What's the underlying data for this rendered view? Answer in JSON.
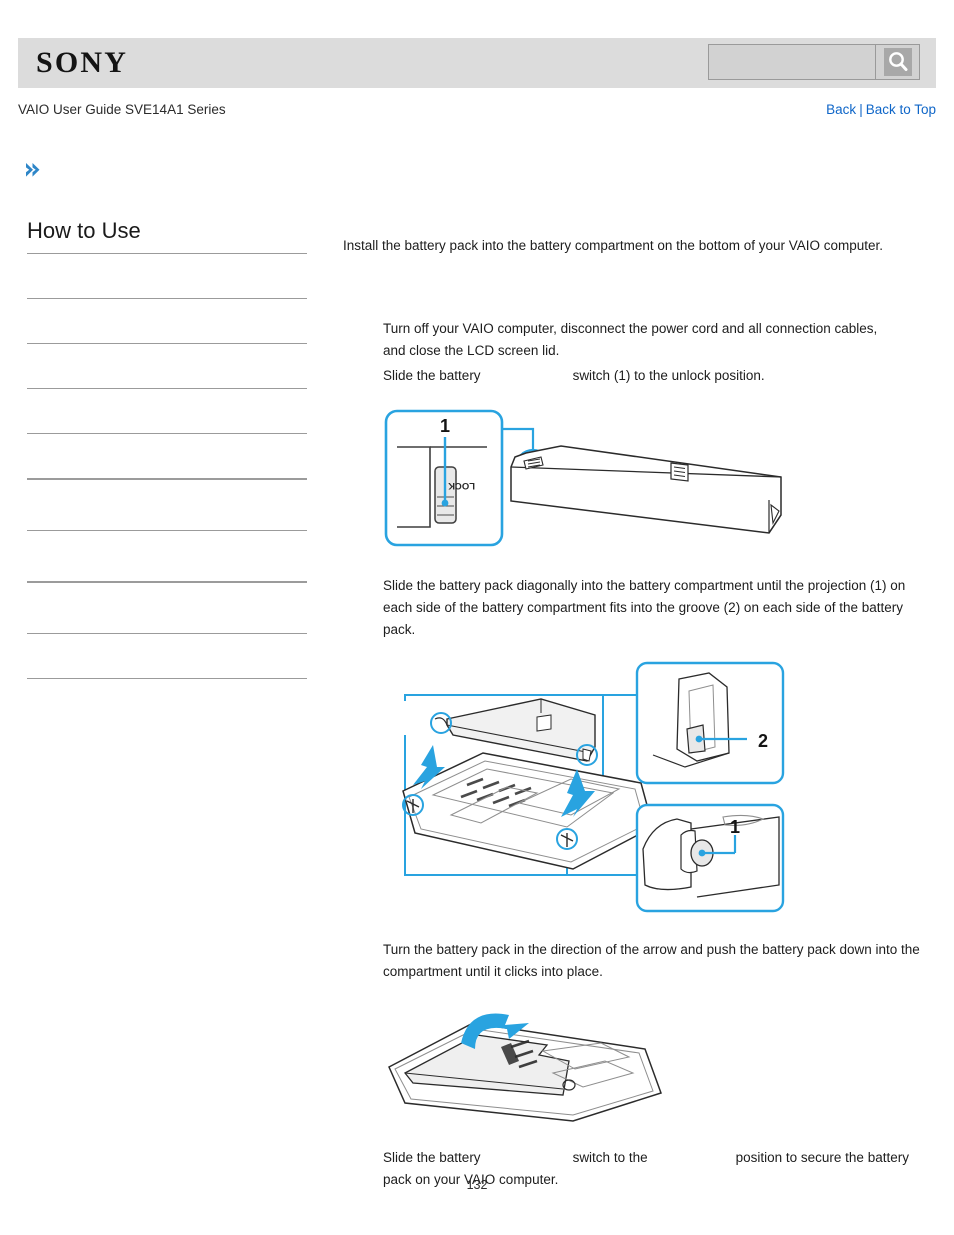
{
  "header": {
    "logo_text": "SONY",
    "search": {
      "value": "",
      "placeholder": "",
      "icon": "search-icon",
      "button_label": ""
    }
  },
  "title_row": {
    "guide_title": "VAIO User Guide SVE14A1 Series",
    "back_label": "Back",
    "separator": "|",
    "back_to_top_label": "Back to Top"
  },
  "breadcrumb": {
    "icon": "double-chevron-right-icon",
    "label": ""
  },
  "sidebar": {
    "heading": "How to Use",
    "items": [
      {
        "label": ""
      },
      {
        "label": ""
      },
      {
        "label": ""
      },
      {
        "label": ""
      },
      {
        "label": ""
      },
      {
        "label": ""
      },
      {
        "label": ""
      },
      {
        "label": ""
      },
      {
        "label": ""
      }
    ]
  },
  "main": {
    "intro": "Install the battery pack into the battery compartment on the bottom of your VAIO computer.",
    "step1_line1": "Turn off your VAIO computer, disconnect the power cord and all connection cables,",
    "step1_line2": "and close the LCD screen lid.",
    "step2_pre": "Slide the battery",
    "step2_post": "switch (1) to the unlock position.",
    "step3": "Slide the battery pack diagonally into the battery compartment until the projection (1) on each side of the battery compartment fits into the groove (2) on each side of the battery pack.",
    "step4": "Turn the battery pack in the direction of the arrow and push the battery pack down into the compartment until it clicks into place.",
    "step5_pre": "Slide the battery",
    "step5_mid": "switch to the",
    "step5_post": "position to secure the battery pack on your VAIO computer."
  },
  "figures": {
    "fig1": {
      "name": "battery-pack-lock-switch-figure",
      "callout_number": "1",
      "switch_label": "LOCK"
    },
    "fig2": {
      "name": "battery-insert-into-compartment-figure",
      "callout_groove": "2",
      "callout_projection": "1"
    },
    "fig3": {
      "name": "battery-push-down-figure"
    }
  },
  "footer": {
    "page_number": "132"
  },
  "colors": {
    "header_bg": "#dcdcdc",
    "link_blue": "#0f66c8",
    "diagram_blue": "#29a3e0",
    "rule_gray": "#9b9b9b"
  }
}
